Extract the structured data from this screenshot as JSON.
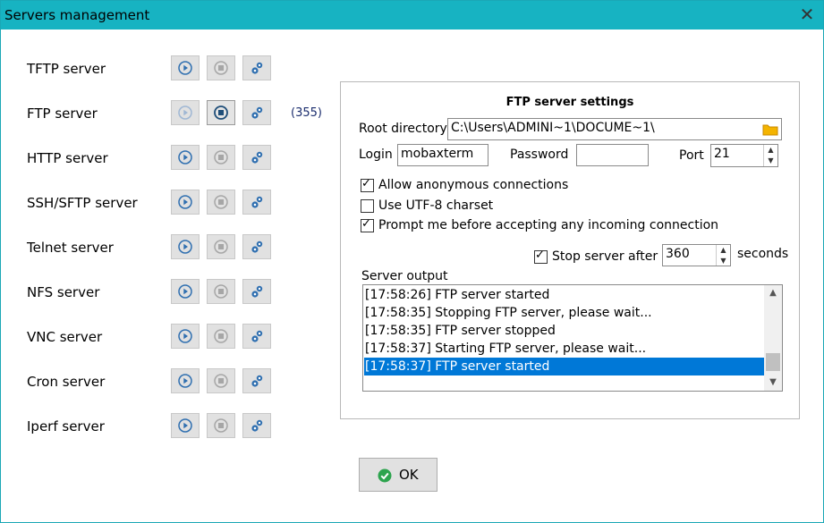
{
  "window": {
    "title": "Servers management",
    "close_glyph": "✕"
  },
  "servers": [
    {
      "name": "TFTP server",
      "count": ""
    },
    {
      "name": "FTP server",
      "count": "(355)"
    },
    {
      "name": "HTTP server",
      "count": ""
    },
    {
      "name": "SSH/SFTP server",
      "count": ""
    },
    {
      "name": "Telnet server",
      "count": ""
    },
    {
      "name": "NFS server",
      "count": ""
    },
    {
      "name": "VNC server",
      "count": ""
    },
    {
      "name": "Cron server",
      "count": ""
    },
    {
      "name": "Iperf server",
      "count": ""
    }
  ],
  "icons": {
    "start": "play-icon",
    "stop": "stop-icon",
    "settings": "gears-icon",
    "folder": "folder-icon",
    "ok": "check-circle-icon"
  },
  "settings": {
    "title": "FTP server settings",
    "root_label": "Root directory",
    "root_value": "C:\\Users\\ADMINI~1\\DOCUME~1\\",
    "login_label": "Login",
    "login_value": "mobaxterm",
    "password_label": "Password",
    "password_value": "",
    "port_label": "Port",
    "port_value": "21",
    "allow_anon_label": "Allow anonymous connections",
    "allow_anon_checked": true,
    "utf8_label": "Use UTF-8 charset",
    "utf8_checked": false,
    "prompt_label": "Prompt me before accepting any incoming connection",
    "prompt_checked": true,
    "stop_after_label": "Stop server after",
    "stop_after_checked": true,
    "stop_after_value": "360",
    "seconds_label": "seconds",
    "output_label": "Server output",
    "output_lines": [
      "[17:58:26] FTP server started",
      "[17:58:35] Stopping FTP server, please wait...",
      "[17:58:35] FTP server stopped",
      "[17:58:37] Starting FTP server, please wait...",
      "[17:58:37] FTP server started"
    ]
  },
  "ok_button": {
    "label": "OK"
  },
  "colors": {
    "titlebar": "#17b3c2",
    "selection": "#0078d7",
    "accent_blue": "#2f6fb0"
  }
}
